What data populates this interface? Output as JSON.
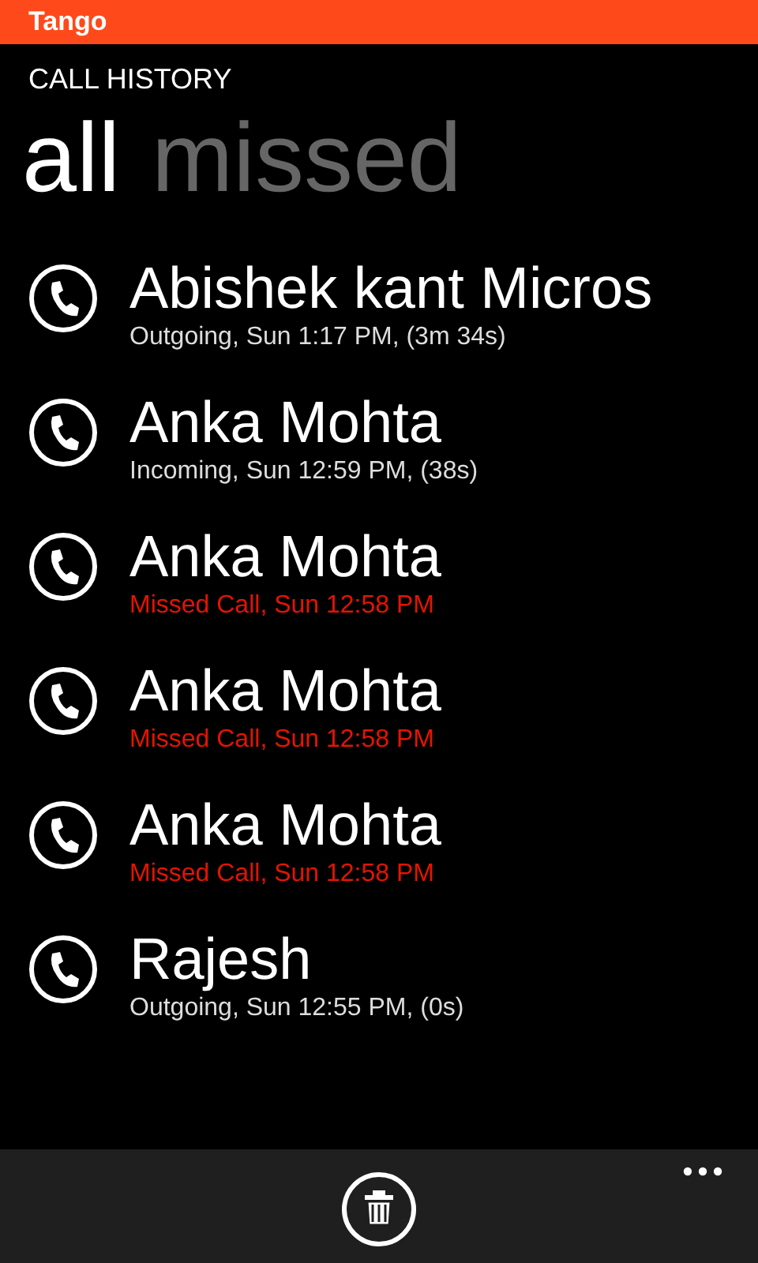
{
  "app_bar_title": "Tango",
  "page_title": "CALL HISTORY",
  "pivots": [
    {
      "label": "all",
      "selected": true
    },
    {
      "label": "missed",
      "selected": false
    }
  ],
  "calls": [
    {
      "name": "Abishek kant Micros",
      "detail": "Outgoing, Sun 1:17 PM, (3m 34s)",
      "kind": "outgoing"
    },
    {
      "name": "Anka Mohta",
      "detail": "Incoming, Sun 12:59 PM, (38s)",
      "kind": "incoming"
    },
    {
      "name": "Anka Mohta",
      "detail": "Missed Call, Sun 12:58 PM",
      "kind": "missed"
    },
    {
      "name": "Anka Mohta",
      "detail": "Missed Call, Sun 12:58 PM",
      "kind": "missed"
    },
    {
      "name": "Anka Mohta",
      "detail": "Missed Call, Sun 12:58 PM",
      "kind": "missed"
    },
    {
      "name": "Rajesh",
      "detail": "Outgoing, Sun 12:55 PM, (0s)",
      "kind": "outgoing"
    }
  ]
}
